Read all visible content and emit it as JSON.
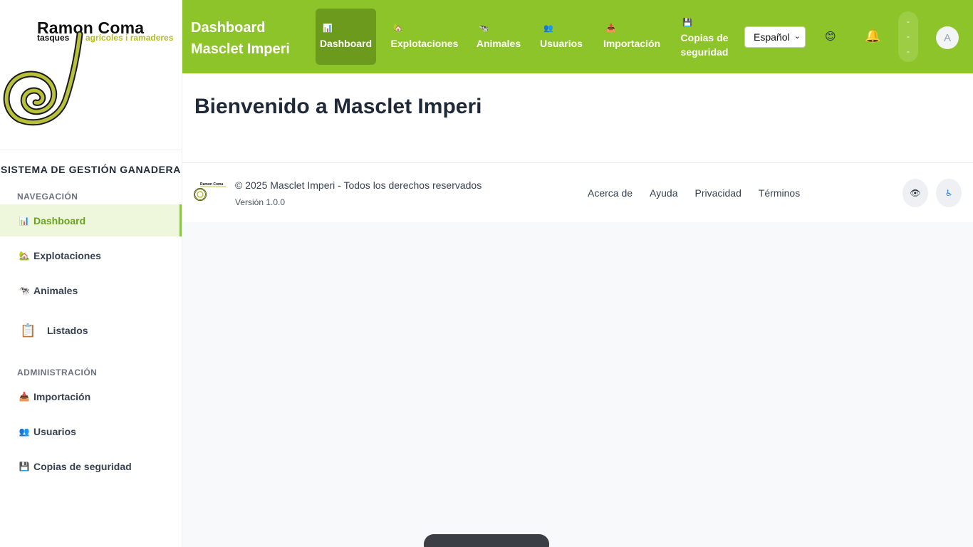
{
  "logo": {
    "title": "Ramon Coma",
    "subtitle_a": "tasques",
    "subtitle_b": "agrícoles i ramaderes"
  },
  "sidebar": {
    "system_title": "SISTEMA DE GESTIÓN GANADERA",
    "sections": {
      "navigation": "NAVEGACIÓN",
      "administration": "ADMINISTRACIÓN"
    },
    "nav": [
      {
        "label": "Dashboard",
        "icon": "chart-icon",
        "glyph": "📊"
      },
      {
        "label": "Explotaciones",
        "icon": "farm-icon",
        "glyph": "🏡"
      },
      {
        "label": "Animales",
        "icon": "cow-icon",
        "glyph": "🐄"
      },
      {
        "label": "Listados",
        "icon": "clipboard-icon",
        "glyph": "📋"
      }
    ],
    "admin": [
      {
        "label": "Importación",
        "icon": "import-icon",
        "glyph": "📥"
      },
      {
        "label": "Usuarios",
        "icon": "users-icon",
        "glyph": "👥"
      },
      {
        "label": "Copias de seguridad",
        "icon": "floppy-icon",
        "glyph": "💾"
      }
    ]
  },
  "topbar": {
    "brand_line1": "Dashboard",
    "brand_line2": "Masclet Imperi",
    "nav": [
      {
        "label": "Dashboard",
        "glyph": "📊"
      },
      {
        "label": "Explotaciones",
        "glyph": "🏡"
      },
      {
        "label": "Animales",
        "glyph": "🐄"
      },
      {
        "label": "Usuarios",
        "glyph": "👥"
      },
      {
        "label": "Importación",
        "glyph": "📥"
      },
      {
        "label": "Copias de seguridad",
        "glyph": "💾"
      }
    ],
    "language": "Español",
    "avatar_initial": "A",
    "dots": [
      "-",
      "-",
      "-"
    ]
  },
  "main": {
    "welcome": "Bienvenido a Masclet Imperi"
  },
  "footer": {
    "copyright": "© 2025 Masclet Imperi - Todos los derechos reservados",
    "version": "Versión 1.0.0",
    "links": [
      "Acerca de",
      "Ayuda",
      "Privacidad",
      "Términos"
    ],
    "btn_eye": "👁",
    "btn_access": "♿"
  },
  "colors": {
    "brand": "#8cc42a",
    "brand_dark": "#6c9a1c",
    "active_bg": "#eef7dc"
  }
}
